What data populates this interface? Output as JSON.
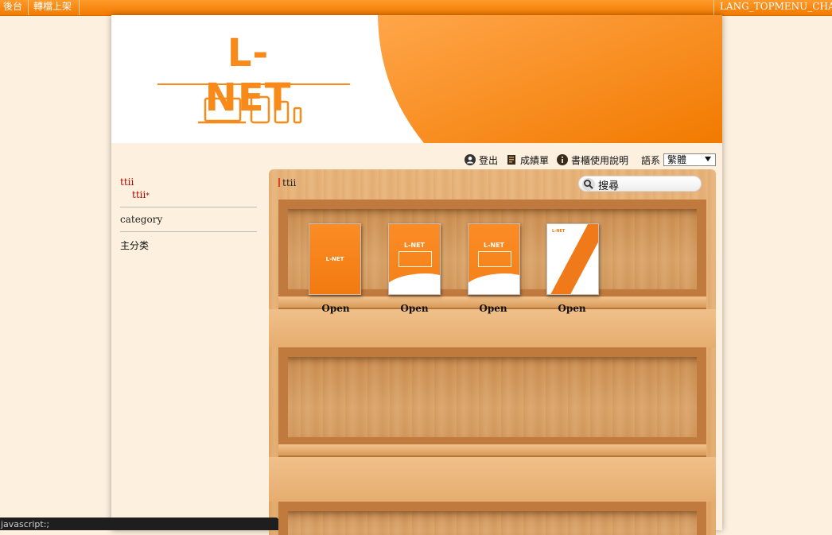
{
  "topbar": {
    "admin_label": "後台",
    "upload_label": "轉檔上架",
    "chat_label": "LANG_TOPMENU_CHAT"
  },
  "banner": {
    "logo_text": "L-NET",
    "brand_color": "#f88a1a"
  },
  "toolbar": {
    "logout_label": "登出",
    "grades_label": "成績單",
    "help_label": "書櫃使用說明",
    "language_label": "語系",
    "language_selected": "繁體"
  },
  "sidebar": {
    "top_link": "ttii",
    "sub_link": "ttii",
    "category_label": "category",
    "main_category_label": "主分类"
  },
  "shelf": {
    "breadcrumb": "ttii",
    "search_placeholder": "搜尋",
    "books": [
      {
        "cover_title": "L-NET",
        "open_label": "Open"
      },
      {
        "cover_title": "L-NET",
        "open_label": "Open"
      },
      {
        "cover_title": "L-NET",
        "open_label": "Open"
      },
      {
        "cover_title": "L-NET",
        "open_label": "Open"
      }
    ]
  },
  "statusbar": {
    "text": "javascript:;"
  }
}
